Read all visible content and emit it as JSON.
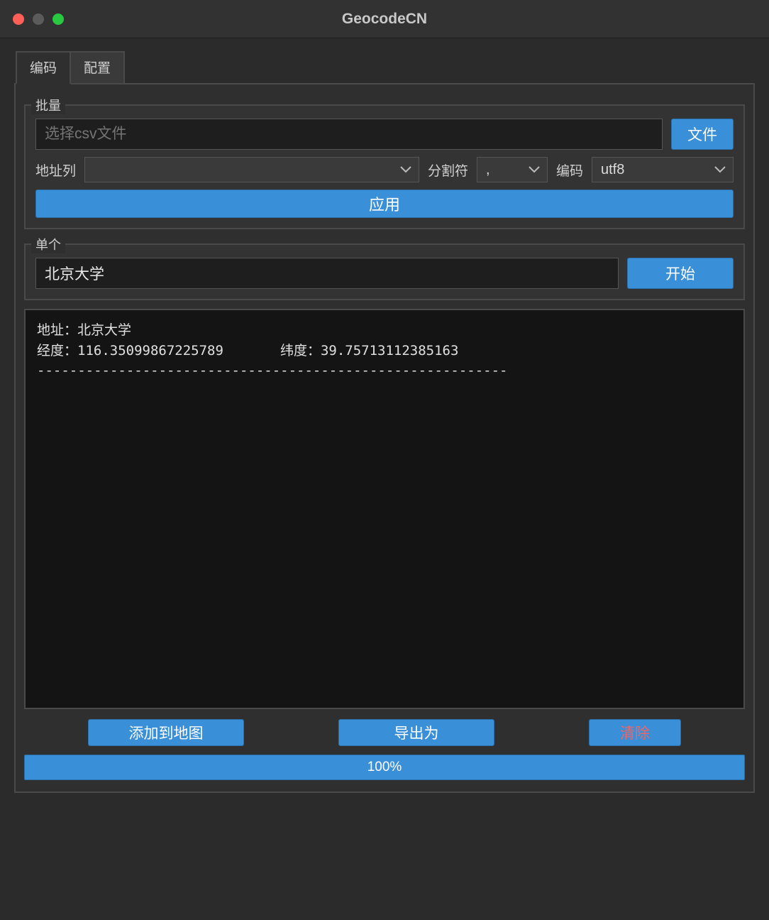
{
  "window": {
    "title": "GeocodeCN"
  },
  "tabs": {
    "encode": "编码",
    "config": "配置"
  },
  "batch": {
    "title": "批量",
    "file_placeholder": "选择csv文件",
    "file_button": "文件",
    "addr_col_label": "地址列",
    "addr_col_value": "",
    "separator_label": "分割符",
    "separator_value": ",",
    "encoding_label": "编码",
    "encoding_value": "utf8",
    "apply_button": "应用"
  },
  "single": {
    "title": "单个",
    "input_value": "北京大学",
    "start_button": "开始"
  },
  "output": {
    "text": "地址：北京大学\n经度：116.35099867225789       纬度：39.75713112385163\n----------------------------------------------------------"
  },
  "footer": {
    "add_to_map": "添加到地图",
    "export_as": "导出为",
    "clear": "清除"
  },
  "progress": {
    "text": "100%"
  }
}
